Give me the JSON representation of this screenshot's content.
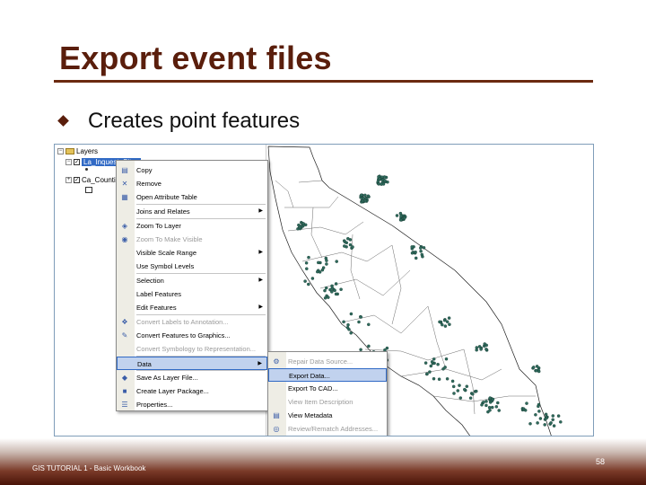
{
  "slide": {
    "title": "Export event files",
    "bullet": "Creates point features",
    "footer_left": "GIS TUTORIAL 1 - Basic Workbook",
    "page_number": "58"
  },
  "colors": {
    "title": "#5a1e0c",
    "rule": "#6b2a10",
    "selection": "#316ac5",
    "menu_highlight": "#c1d2ee",
    "point_fill": "#2f6a5c"
  },
  "toc": {
    "root_label": "Layers",
    "selected_layer": "La_Inquest_Sites",
    "second_layer": "Ca_Counties",
    "icons": {
      "expander": "minus-box-icon",
      "checkbox": "checkbox-icon",
      "layers": "layers-icon"
    }
  },
  "context_menu": {
    "items": [
      {
        "label": "Copy",
        "icon": "copy-icon",
        "glyph": "▤",
        "submenu": false,
        "disabled": false
      },
      {
        "label": "Remove",
        "icon": "remove-icon",
        "glyph": "✕",
        "submenu": false,
        "disabled": false
      },
      {
        "label": "Open Attribute Table",
        "icon": "table-icon",
        "glyph": "▦",
        "submenu": false,
        "disabled": false
      },
      {
        "label": "Joins and Relates",
        "icon": "",
        "glyph": "",
        "submenu": true,
        "disabled": false
      },
      {
        "label": "Zoom To Layer",
        "icon": "zoom-to-layer-icon",
        "glyph": "◈",
        "submenu": false,
        "disabled": false
      },
      {
        "label": "Zoom To Make Visible",
        "icon": "zoom-visible-icon",
        "glyph": "◉",
        "submenu": false,
        "disabled": true
      },
      {
        "label": "Visible Scale Range",
        "icon": "",
        "glyph": "",
        "submenu": true,
        "disabled": false
      },
      {
        "label": "Use Symbol Levels",
        "icon": "",
        "glyph": "",
        "submenu": false,
        "disabled": false
      },
      {
        "label": "Selection",
        "icon": "",
        "glyph": "",
        "submenu": true,
        "disabled": false
      },
      {
        "label": "Label Features",
        "icon": "",
        "glyph": "",
        "submenu": false,
        "disabled": false
      },
      {
        "label": "Edit Features",
        "icon": "",
        "glyph": "",
        "submenu": true,
        "disabled": false
      },
      {
        "label": "Convert Labels to Annotation...",
        "icon": "annotation-icon",
        "glyph": "❖",
        "submenu": false,
        "disabled": true
      },
      {
        "label": "Convert Features to Graphics...",
        "icon": "graphics-icon",
        "glyph": "✎",
        "submenu": false,
        "disabled": false
      },
      {
        "label": "Convert Symbology to Representation...",
        "icon": "",
        "glyph": "",
        "submenu": false,
        "disabled": true
      },
      {
        "label": "Data",
        "icon": "",
        "glyph": "",
        "submenu": true,
        "disabled": false,
        "highlighted": true
      },
      {
        "label": "Save As Layer File...",
        "icon": "save-layer-icon",
        "glyph": "◆",
        "submenu": false,
        "disabled": false
      },
      {
        "label": "Create Layer Package...",
        "icon": "package-icon",
        "glyph": "■",
        "submenu": false,
        "disabled": false
      },
      {
        "label": "Properties...",
        "icon": "properties-icon",
        "glyph": "☰",
        "submenu": false,
        "disabled": false
      }
    ]
  },
  "data_submenu": {
    "items": [
      {
        "label": "Repair Data Source...",
        "icon": "repair-icon",
        "glyph": "⚙",
        "disabled": true
      },
      {
        "label": "Export Data...",
        "icon": "",
        "glyph": "",
        "disabled": false,
        "highlighted": true
      },
      {
        "label": "Export To CAD...",
        "icon": "",
        "glyph": "",
        "disabled": false
      },
      {
        "label": "View Item Description",
        "icon": "",
        "glyph": "",
        "disabled": true
      },
      {
        "label": "View Metadata",
        "icon": "metadata-icon",
        "glyph": "▤",
        "disabled": false
      },
      {
        "label": "Review/Rematch Addresses...",
        "icon": "rematch-icon",
        "glyph": "◎",
        "disabled": true
      }
    ]
  }
}
